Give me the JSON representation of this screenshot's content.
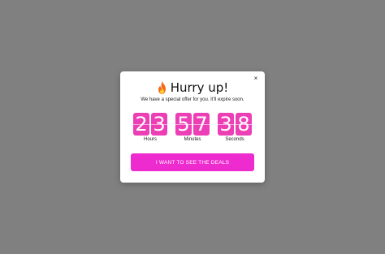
{
  "popup": {
    "close_label": "×",
    "title_icon": "fire-icon",
    "title": "Hurry up!",
    "subtitle": "We have a special offer for you. It'll expire soon.",
    "accent_color": "#ec3fb6",
    "countdown": [
      {
        "label": "Hours",
        "digits": [
          "2",
          "3"
        ]
      },
      {
        "label": "Minutes",
        "digits": [
          "5",
          "7"
        ]
      },
      {
        "label": "Seconds",
        "digits": [
          "3",
          "8"
        ]
      }
    ],
    "cta_label": "I WANT TO SEE THE DEALS"
  }
}
